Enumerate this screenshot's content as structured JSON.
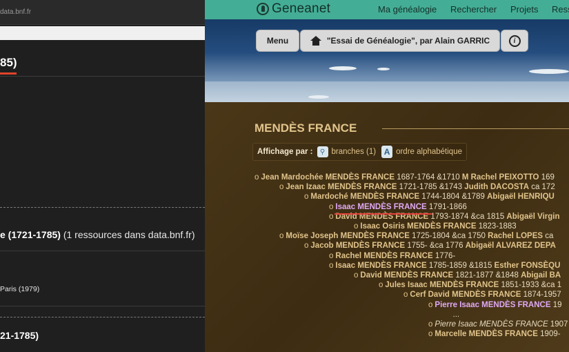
{
  "left": {
    "url": "data.bnf.fr",
    "title1": "85)",
    "heading_bold": "e (1721-1785)",
    "heading_rest": " (1 ressources dans data.bnf.fr)",
    "small_text": "Paris (1979)",
    "title2": "21-1785)"
  },
  "right": {
    "logo_text": "Geneanet",
    "nav": [
      "Ma généalogie",
      "Rechercher",
      "Projets",
      "Ress"
    ],
    "menu_button": "Menu",
    "breadcrumb_button": "\"Essai de Généalogie\", par Alain GARRIC",
    "family_title": "MENDÈS FRANCE",
    "affichage": {
      "label": "Affichage par :",
      "branches": "branches (1)",
      "alpha": "ordre alphabétique"
    },
    "tree": [
      {
        "bullet": "o",
        "name": "Jean Mardochée MENDÈS FRANCE",
        "info": " 1687-1764 &1710 ",
        "spouse": "M Rachel PEIXOTTO",
        "tail": " 169"
      },
      {
        "bullet": "o",
        "name": "Jean Izaac MENDÈS FRANCE",
        "info": " 1721-1785 &1743 ",
        "spouse": "Judith DACOSTA",
        "tail": " ca 172"
      },
      {
        "bullet": "o",
        "name": "Mardoché MENDÈS FRANCE",
        "info": " 1744-1804 &1789 ",
        "spouse": "Abigaël HENRIQU",
        "tail": ""
      },
      {
        "bullet": "o",
        "name": "Isaac MENDÈS FRANCE",
        "info": " 1791-1866",
        "spouse": "",
        "tail": ""
      },
      {
        "bullet": "o",
        "name": "David MENDÈS FRANCE",
        "info": " 1793-1874 &ca 1815 ",
        "spouse": "Abigaël Virgin",
        "tail": ""
      },
      {
        "bullet": "o",
        "name": "Isaac Osiris MENDÈS FRANCE",
        "info": " 1823-1883",
        "spouse": "",
        "tail": ""
      },
      {
        "bullet": "o",
        "name": "Moïse Joseph MENDÈS FRANCE",
        "info": " 1725-1804 &ca 1750 ",
        "spouse": "Rachel LOPES",
        "tail": " ca"
      },
      {
        "bullet": "o",
        "name": "Jacob MENDÈS FRANCE",
        "info": " 1755- &ca 1776 ",
        "spouse": "Abigaël ALVAREZ DEPA",
        "tail": ""
      },
      {
        "bullet": "o",
        "name": "Rachel MENDÈS FRANCE",
        "info": " 1776-",
        "spouse": "",
        "tail": ""
      },
      {
        "bullet": "o",
        "name": "Isaac MENDÈS FRANCE",
        "info": " 1785-1859 &1815 ",
        "spouse": "Esther FONSÈQU",
        "tail": ""
      },
      {
        "bullet": "o",
        "name": "David MENDÈS FRANCE",
        "info": " 1821-1877 &1848 ",
        "spouse": "Abigail BA",
        "tail": ""
      },
      {
        "bullet": "o",
        "name": "Jules Isaac MENDÈS FRANCE",
        "info": " 1851-1933 &ca 1",
        "spouse": "",
        "tail": ""
      },
      {
        "bullet": "o",
        "name": "Cerf David MENDÈS FRANCE",
        "info": " 1874-1957",
        "spouse": "",
        "tail": ""
      },
      {
        "bullet": "o",
        "name": "Pierre Isaac MENDÈS FRANCE",
        "info": " 19",
        "spouse": "",
        "tail": ""
      },
      {
        "bullet": "",
        "name": "...",
        "info": "",
        "spouse": "",
        "tail": ""
      },
      {
        "bullet": "o",
        "name": "Pierre Isaac MENDÈS FRANCE",
        "info": " 1907",
        "spouse": "",
        "tail": ""
      },
      {
        "bullet": "o",
        "name": "Marcelle MENDÈS FRANCE",
        "info": " 1909-",
        "spouse": "",
        "tail": ""
      }
    ]
  },
  "colors": {
    "geneanet_green": "#44ad95",
    "name_gold": "#e1c48c",
    "highlight_violet": "#e0a9f5",
    "underline_red": "#e7423c"
  }
}
